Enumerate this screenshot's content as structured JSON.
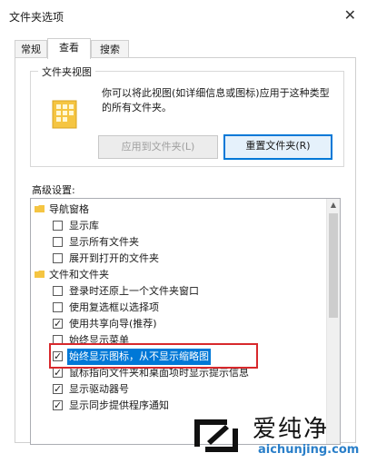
{
  "window": {
    "title": "文件夹选项",
    "close_glyph": "✕"
  },
  "tabs": [
    {
      "label": "常规",
      "active": false
    },
    {
      "label": "查看",
      "active": true
    },
    {
      "label": "搜索",
      "active": false
    }
  ],
  "folder_views": {
    "group_title": "文件夹视图",
    "description": "你可以将此视图(如详细信息或图标)应用于这种类型的所有文件夹。",
    "apply_button": "应用到文件夹(L)",
    "reset_button": "重置文件夹(R)"
  },
  "advanced": {
    "label": "高级设置:",
    "items": [
      {
        "type": "group",
        "label": "导航窗格"
      },
      {
        "type": "checkbox",
        "label": "显示库",
        "checked": false
      },
      {
        "type": "checkbox",
        "label": "显示所有文件夹",
        "checked": false
      },
      {
        "type": "checkbox",
        "label": "展开到打开的文件夹",
        "checked": false
      },
      {
        "type": "group",
        "label": "文件和文件夹"
      },
      {
        "type": "checkbox",
        "label": "登录时还原上一个文件夹窗口",
        "checked": false
      },
      {
        "type": "checkbox",
        "label": "使用复选框以选择项",
        "checked": false
      },
      {
        "type": "checkbox",
        "label": "使用共享向导(推荐)",
        "checked": true
      },
      {
        "type": "checkbox",
        "label": "始终显示菜单",
        "checked": false
      },
      {
        "type": "checkbox",
        "label": "始终显示图标，从不显示缩略图",
        "checked": true,
        "selected": true
      },
      {
        "type": "checkbox",
        "label": "鼠标指向文件夹和桌面项时显示提示信息",
        "checked": true
      },
      {
        "type": "checkbox",
        "label": "显示驱动器号",
        "checked": true
      },
      {
        "type": "checkbox",
        "label": "显示同步提供程序通知",
        "checked": true
      }
    ]
  },
  "watermark": {
    "name": "爱纯净",
    "url": "aichunjing.com"
  },
  "colors": {
    "accent": "#0078d7",
    "highlight_frame": "#d8282c",
    "folder_yellow": "#f5c542",
    "watermark_blue": "#2a7fc9"
  }
}
